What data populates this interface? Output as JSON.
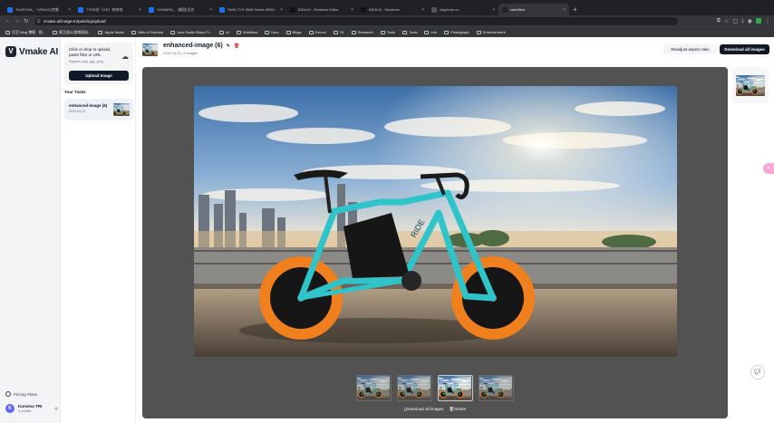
{
  "browser": {
    "tabs": [
      {
        "title": "TANSYNA_（VENUS)完美"
      },
      {
        "title": "TXSB芸（3卡）哈哈哈"
      },
      {
        "title": "SHINARA_（美国)全名"
      },
      {
        "title": "SNW-TVS SMB Series 600M"
      },
      {
        "title": "IDEA AI - Realtime Editor"
      },
      {
        "title": "IDEA AI - Solutions"
      },
      {
        "title": "cityphoto.co"
      },
      {
        "title": "cat/effect",
        "active": true
      }
    ],
    "url": "vmake.ai/image-to/painting/upload",
    "bookmarks": [
      "豆豆 Blog 博客 · 前...",
      "保卫战斗游戏网站...",
      "Apple Music",
      "Web of Science",
      "Jazz Radio Blues Fr...",
      "AI",
      "Workflow",
      "Kurs",
      "Blogs",
      "School",
      "TA",
      "Research",
      "Tools",
      "Tools",
      "Info",
      "Photograph",
      "Entertainment"
    ]
  },
  "sidebar": {
    "logo_text": "Vmake AI",
    "pricing": "Pricing Plans",
    "user_initial": "K",
    "user_name": "Karvena TRI",
    "user_credits": "4 credits"
  },
  "panel": {
    "upload_text": "Click or drop to upload, paste files or URL",
    "upload_support": "Support .png, .jpg, .jpeg",
    "upload_button": "Upload Image",
    "tasks_heading": "Your Tasks",
    "task_name": "enhanced-image (6)",
    "task_date": "2024-04-23"
  },
  "header": {
    "title": "enhanced-image (6)",
    "subtitle": "2024-04-23 | 4 images",
    "readjust_button": "Readjust aspect ratio",
    "download_all_button": "Download all images"
  },
  "viewer": {
    "download_all": "Download all images",
    "delete": "Delete",
    "selected_thumb_index": 2
  },
  "colors": {
    "viewer_bg": "#525252",
    "bike_frame": "#2ec4c9",
    "bike_wheel": "#f07f1e",
    "primary_button": "#111827"
  }
}
